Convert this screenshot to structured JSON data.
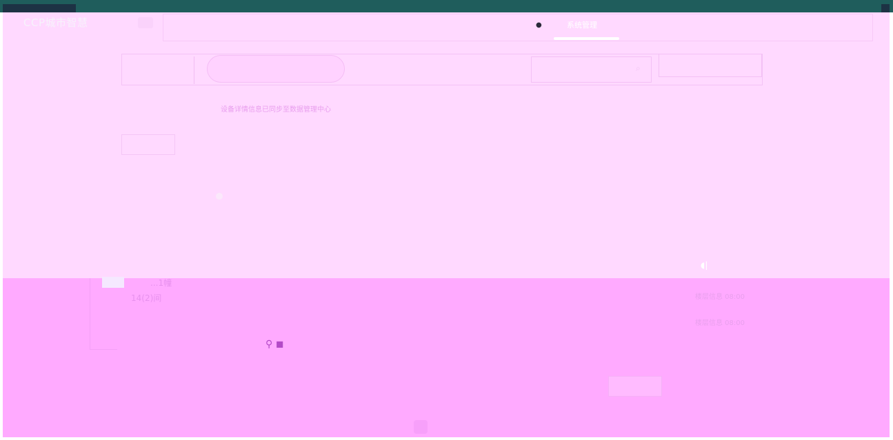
{
  "app": {
    "title": "CCP城市智慧"
  },
  "header": {
    "nav_active_label": "系统管理",
    "nav_right_label": "",
    "nav_dot": "●"
  },
  "tabs": {
    "first_label": "",
    "second_label": "",
    "search_placeholder": "",
    "search_icon": "search-icon",
    "action_label": ""
  },
  "notice": {
    "text": "设备详情信息已同步至数据管理中心",
    "right_text": ""
  },
  "panel": {
    "small_box_label": ""
  },
  "info": {
    "marker": "◖|",
    "line_1": "楼层信息 08:00",
    "line_2": "楼层信息 08:00"
  },
  "building": {
    "line_1": "...1幢",
    "line_2": "14(2)间"
  },
  "mid_icons": "⚲ ◼",
  "buttons": {
    "ghost_label": "",
    "primary_label": ""
  },
  "colors": {
    "teal_bar": "#1f5d5c",
    "navy": "#1d3244",
    "canvas": "#ffd9ff",
    "canvas_lower": "#ffaaff"
  }
}
